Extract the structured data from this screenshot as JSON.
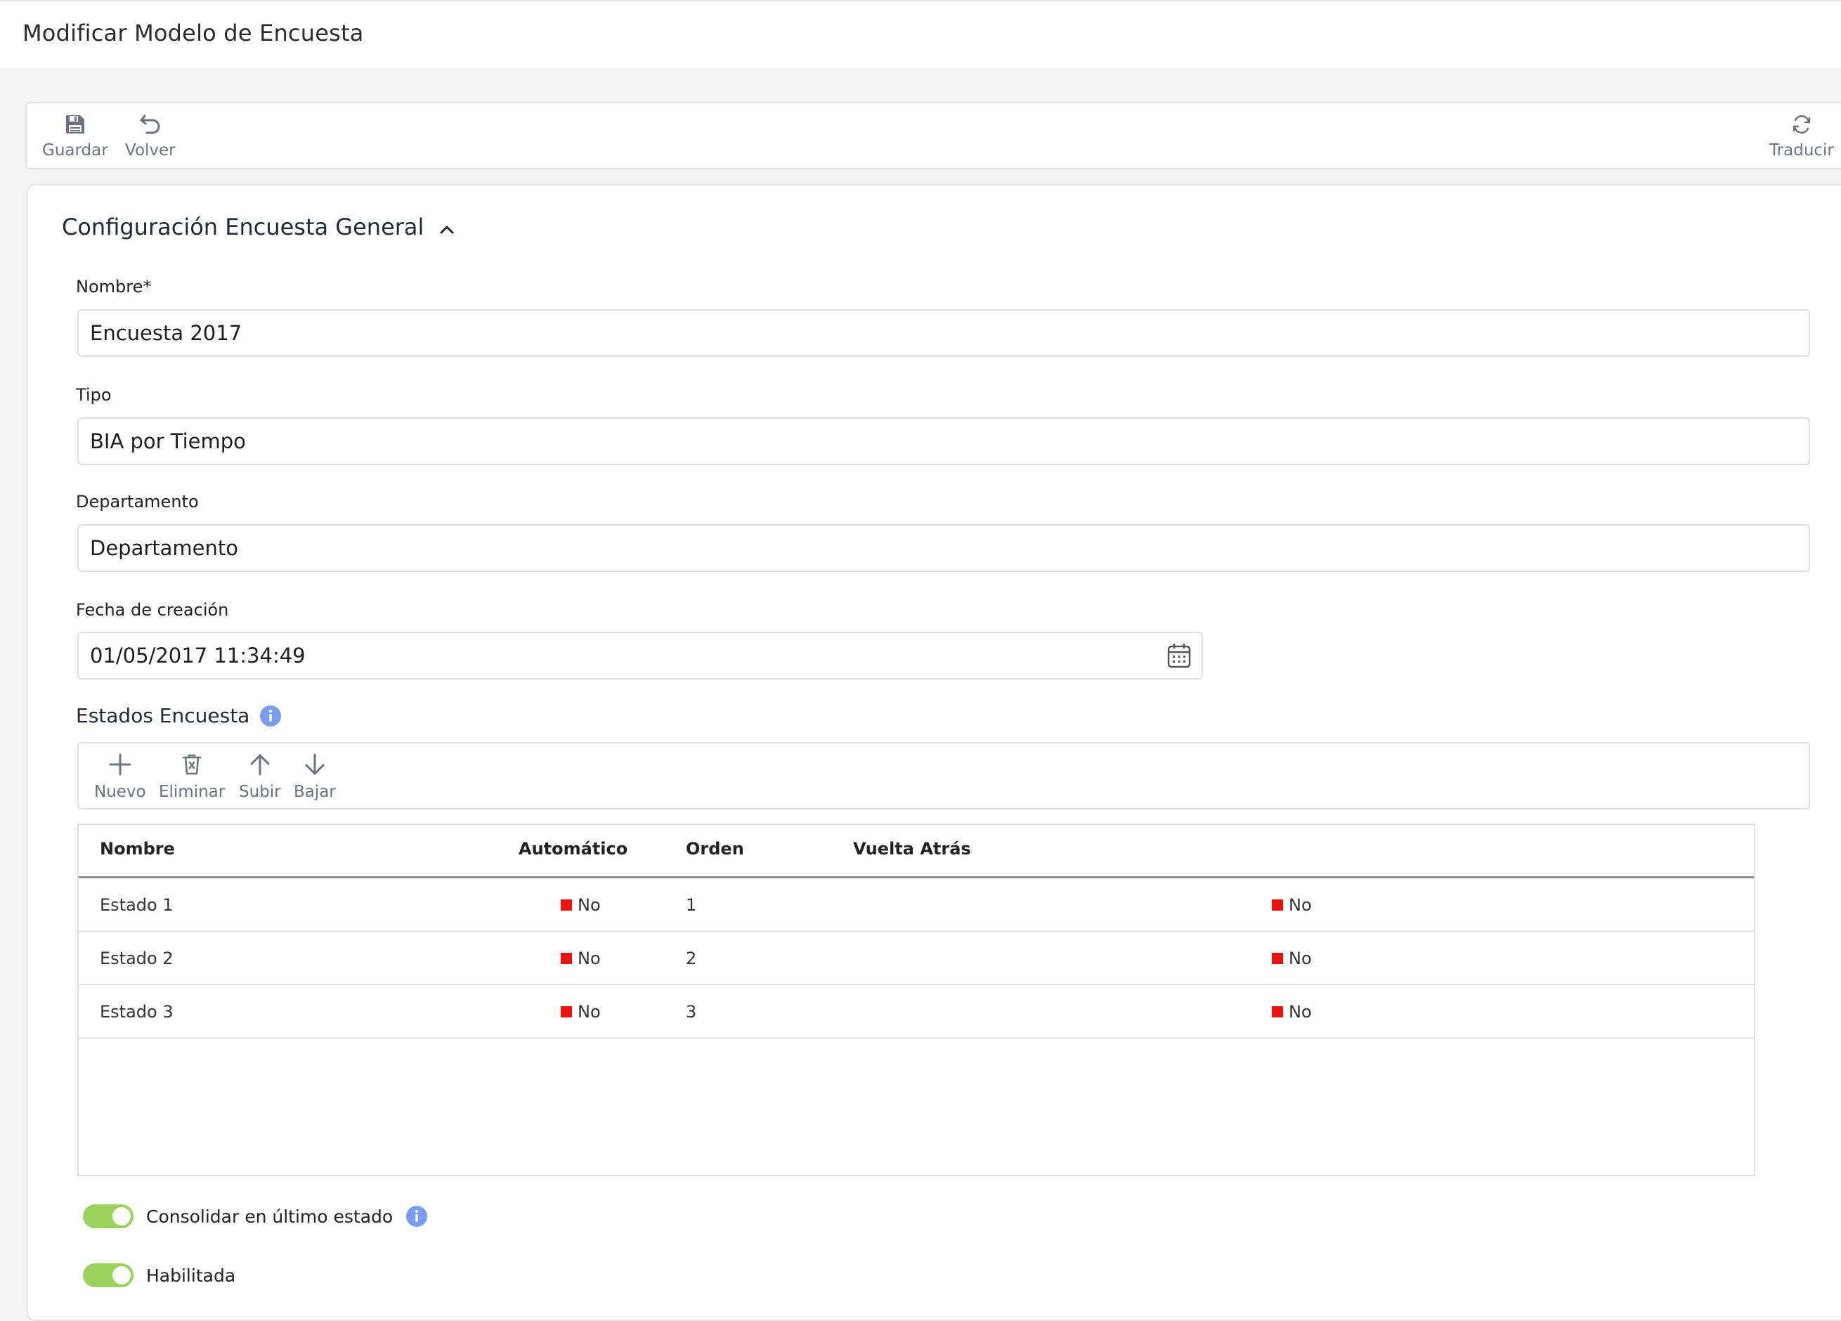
{
  "header": {
    "title": "Modificar Modelo de Encuesta"
  },
  "toolbar": {
    "save_label": "Guardar",
    "back_label": "Volver",
    "translate_label": "Traducir"
  },
  "section": {
    "title": "Configuración Encuesta General"
  },
  "form": {
    "nombre_label": "Nombre*",
    "nombre_value": "Encuesta 2017",
    "tipo_label": "Tipo",
    "tipo_value": "BIA por Tiempo",
    "departamento_label": "Departamento",
    "departamento_value": "Departamento",
    "fecha_label": "Fecha de creación",
    "fecha_value": "01/05/2017 11:34:49"
  },
  "estados": {
    "title": "Estados Encuesta",
    "toolbar": {
      "new_label": "Nuevo",
      "delete_label": "Eliminar",
      "up_label": "Subir",
      "down_label": "Bajar"
    },
    "columns": [
      "Nombre",
      "Automático",
      "Orden",
      "Vuelta Atrás"
    ],
    "rows": [
      {
        "nombre": "Estado 1",
        "automatico": "No",
        "orden": "1",
        "vuelta": "No"
      },
      {
        "nombre": "Estado 2",
        "automatico": "No",
        "orden": "2",
        "vuelta": "No"
      },
      {
        "nombre": "Estado 3",
        "automatico": "No",
        "orden": "3",
        "vuelta": "No"
      }
    ]
  },
  "toggles": {
    "consolidar_label": "Consolidar en último estado",
    "consolidar_on": true,
    "habilitada_label": "Habilitada",
    "habilitada_on": true
  },
  "colors": {
    "toggle_on": "#9bd35a",
    "status_no": "#ee1111",
    "info": "#7a9cf5"
  }
}
